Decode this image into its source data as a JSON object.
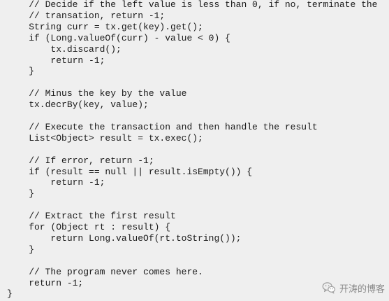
{
  "code_lines": [
    "    // Decide if the left value is less than 0, if no, terminate the",
    "    // transation, return -1;",
    "    String curr = tx.get(key).get();",
    "    if (Long.valueOf(curr) - value < 0) {",
    "        tx.discard();",
    "        return -1;",
    "    }",
    "",
    "    // Minus the key by the value",
    "    tx.decrBy(key, value);",
    "",
    "    // Execute the transaction and then handle the result",
    "    List<Object> result = tx.exec();",
    "",
    "    // If error, return -1;",
    "    if (result == null || result.isEmpty()) {",
    "        return -1;",
    "    }",
    "",
    "    // Extract the first result",
    "    for (Object rt : result) {",
    "        return Long.valueOf(rt.toString());",
    "    }",
    "",
    "    // The program never comes here.",
    "    return -1;",
    "}"
  ],
  "watermark": {
    "text": "开涛的博客",
    "icon": "wechat-icon"
  }
}
